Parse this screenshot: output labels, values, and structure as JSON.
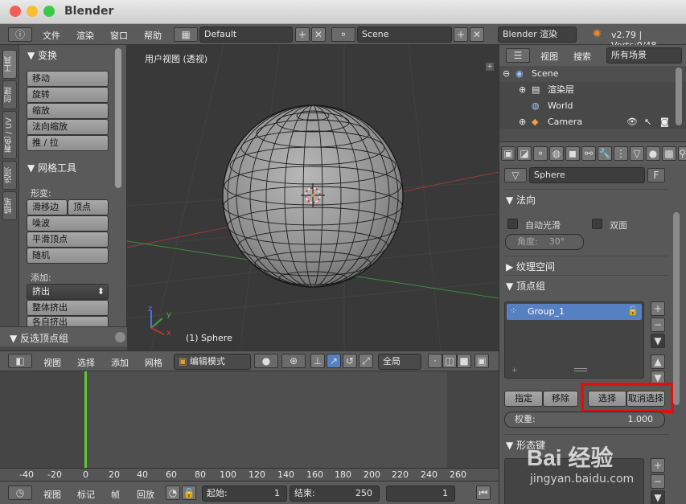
{
  "window": {
    "title": "Blender"
  },
  "colors": {
    "red_close": "#f25f58",
    "yellow_min": "#fbbe2e",
    "green_max": "#3bc94a",
    "accent_blue": "#5680c2",
    "highlight_red": "#e01010"
  },
  "info_header": {
    "menus": [
      "文件",
      "渲染",
      "窗口",
      "帮助"
    ],
    "screen_layout": "Default",
    "scene": "Scene",
    "render_engine": "Blender 渲染",
    "version_text": "v2.79 | Verts:0/48"
  },
  "tool_shelf": {
    "tabs": [
      "工具",
      "创建",
      "着色 / UV",
      "选项",
      "蜡笔"
    ],
    "transform_panel": {
      "title": "变换",
      "buttons": [
        "移动",
        "旋转",
        "缩放",
        "法向缩放",
        "推 / 拉"
      ]
    },
    "mesh_tools_panel": {
      "title": "网格工具",
      "deform_label": "形变:",
      "slide_edge": "滑移边",
      "vertex": "顶点",
      "deform_buttons": [
        "噪波",
        "平滑顶点",
        "随机"
      ],
      "add_label": "添加:",
      "extrude": "挤出",
      "add_buttons": [
        "整体挤出",
        "各自挤出"
      ]
    },
    "last_operator": "反选顶点组"
  },
  "viewport": {
    "view_name": "用户视图 (透视)",
    "object_label": "(1) Sphere",
    "axis_x": "x",
    "axis_y": "y",
    "axis_z": "z"
  },
  "viewport_header": {
    "menus": [
      "视图",
      "选择",
      "添加",
      "网格"
    ],
    "mode": "编辑模式",
    "pivot": "全局"
  },
  "timeline": {
    "ruler": [
      "-40",
      "-20",
      "0",
      "20",
      "40",
      "60",
      "80",
      "100",
      "120",
      "140",
      "160",
      "180",
      "200",
      "220",
      "240",
      "260"
    ],
    "current_frame_marker": 0,
    "menus": [
      "视图",
      "标记",
      "帧",
      "回放"
    ],
    "start_label": "起始:",
    "start_value": "1",
    "end_label": "结束:",
    "end_value": "250",
    "current_frame": "1"
  },
  "outliner": {
    "view_menu": "视图",
    "search_menu": "搜索",
    "filter": "所有场景",
    "rows": [
      "Scene",
      "渲染层",
      "World",
      "Camera"
    ]
  },
  "properties": {
    "mesh_name": "Sphere",
    "fake_user": "F",
    "normals": {
      "title": "法向",
      "auto_smooth": "自动光滑",
      "double_sided": "双面",
      "angle_label": "角度:",
      "angle_value": "30°"
    },
    "texture_space": {
      "title": "纹理空间"
    },
    "vertex_groups": {
      "title": "顶点组",
      "groups": [
        "Group_1"
      ],
      "assign": "指定",
      "remove": "移除",
      "select": "选择",
      "deselect": "取消选择",
      "weight_label": "权重:",
      "weight_value": "1.000"
    },
    "shape_keys": {
      "title": "形态键"
    }
  },
  "watermark": {
    "text": "Bai 经验",
    "subtext": "jingyan.baidu.com"
  }
}
